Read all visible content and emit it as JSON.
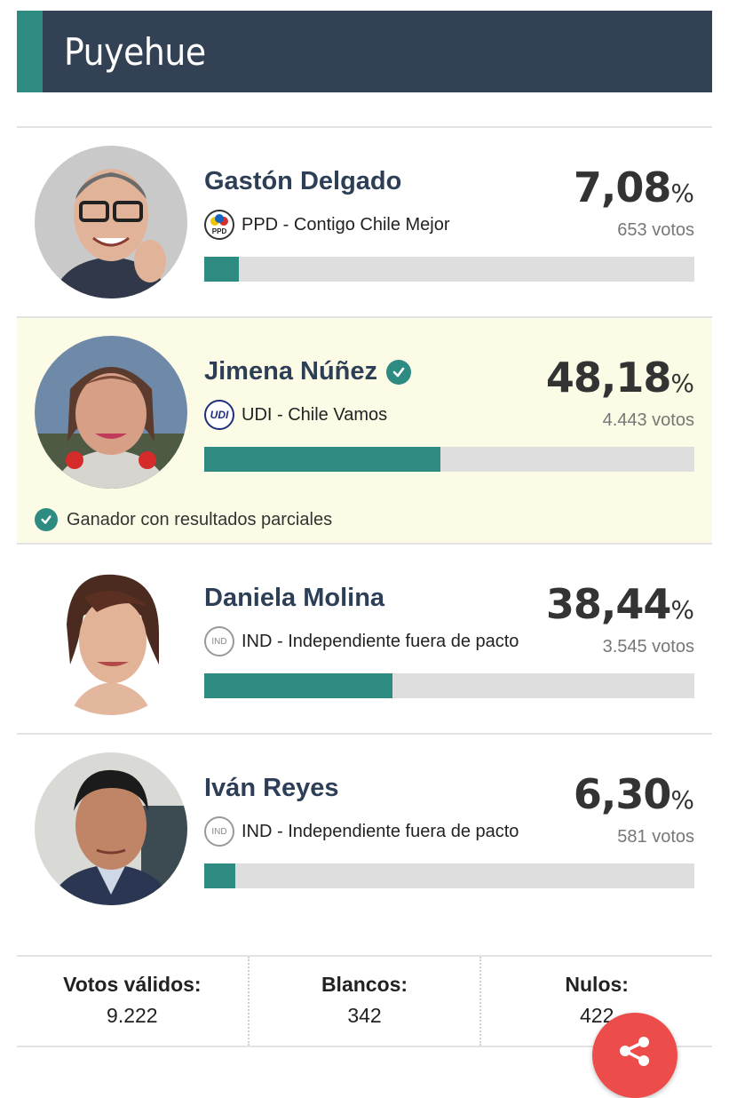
{
  "header": {
    "title": "Puyehue"
  },
  "candidates": [
    {
      "name": "Gastón Delgado",
      "party": "PPD - Contigo Chile Mejor",
      "party_logo": "PPD",
      "percent": "7,08",
      "percent_symbol": "%",
      "votes": "653 votos",
      "share": 7.08,
      "winner": false
    },
    {
      "name": "Jimena Núñez",
      "party": "UDI - Chile Vamos",
      "party_logo": "UDI",
      "percent": "48,18",
      "percent_symbol": "%",
      "votes": "4.443 votos",
      "share": 48.18,
      "winner": true,
      "winner_note": "Ganador con resultados parciales"
    },
    {
      "name": "Daniela Molina",
      "party": "IND - Independiente fuera de pacto",
      "party_logo": "IND",
      "percent": "38,44",
      "percent_symbol": "%",
      "votes": "3.545 votos",
      "share": 38.44,
      "winner": false
    },
    {
      "name": "Iván Reyes",
      "party": "IND - Independiente fuera de pacto",
      "party_logo": "IND",
      "percent": "6,30",
      "percent_symbol": "%",
      "votes": "581 votos",
      "share": 6.3,
      "winner": false
    }
  ],
  "totals": {
    "valid_label": "Votos válidos:",
    "valid_value": "9.222",
    "blank_label": "Blancos:",
    "blank_value": "342",
    "null_label": "Nulos:",
    "null_value": "422"
  },
  "colors": {
    "header_bg": "#334155",
    "accent": "#2e8b82",
    "winner_bg": "#fcfbe5",
    "share_button": "#ec4d4a"
  },
  "icons": {
    "verified": "check-circle-icon",
    "share": "share-icon"
  }
}
